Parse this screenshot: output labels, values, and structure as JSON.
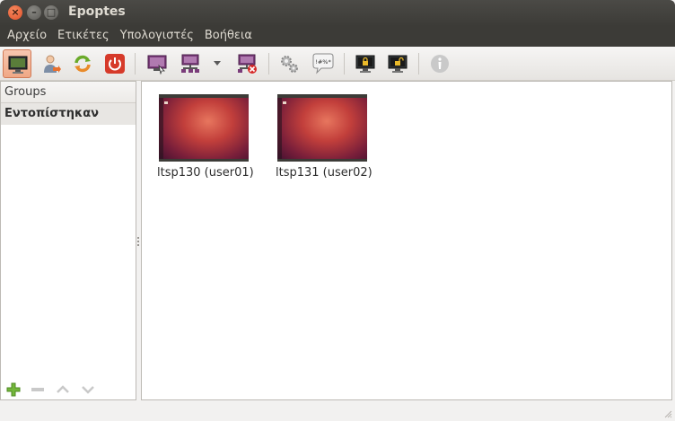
{
  "window": {
    "title": "Epoptes"
  },
  "menubar": {
    "items": [
      "Αρχείο",
      "Ετικέτες",
      "Υπολογιστές",
      "Βοήθεια"
    ]
  },
  "toolbar": {
    "buttons": [
      {
        "name": "observe-screen",
        "icon": "monitor-icon",
        "active": true
      },
      {
        "name": "login-user",
        "icon": "user-arrow-icon"
      },
      {
        "name": "reboot",
        "icon": "refresh-icon"
      },
      {
        "name": "shutdown",
        "icon": "power-icon"
      },
      {
        "name": "broadcast-screen",
        "icon": "broadcast-monitor-icon"
      },
      {
        "name": "broadcast-windowed",
        "icon": "network-monitor-icon"
      },
      {
        "name": "broadcast-options",
        "icon": "dropdown-arrow-icon"
      },
      {
        "name": "stop-broadcast",
        "icon": "stop-broadcast-icon"
      },
      {
        "name": "execute-command",
        "icon": "gears-icon"
      },
      {
        "name": "send-message",
        "icon": "speech-bubble-icon",
        "glyph": "!#%*"
      },
      {
        "name": "lock-screen",
        "icon": "lock-monitor-icon"
      },
      {
        "name": "unlock-screen",
        "icon": "unlock-monitor-icon"
      },
      {
        "name": "information",
        "icon": "info-icon"
      }
    ]
  },
  "sidebar": {
    "header": "Groups",
    "items": [
      "Εντοπίστηκαν"
    ],
    "footer_buttons": [
      "add-icon",
      "remove-icon",
      "move-up-icon",
      "move-down-icon"
    ]
  },
  "clients": [
    {
      "label": "ltsp130 (user01)"
    },
    {
      "label": "ltsp131 (user02)"
    }
  ],
  "colors": {
    "titlebar": "#3c3b37",
    "menu_text": "#dfdbd2",
    "close_button": "#e0502a",
    "active_tool": "#f0a886",
    "wallpaper": "#c23f3b"
  }
}
